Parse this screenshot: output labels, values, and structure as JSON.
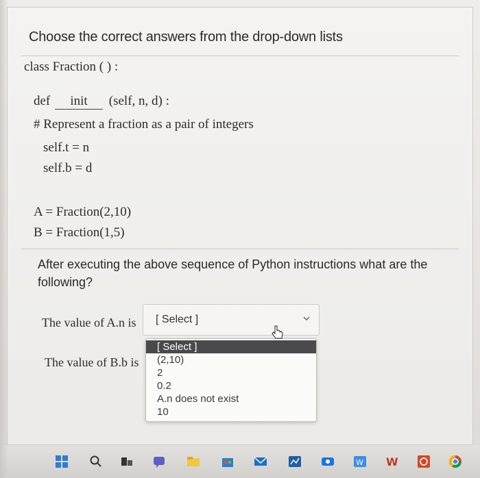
{
  "question": {
    "title": "Choose the correct answers from the drop-down lists",
    "code": {
      "class_line": "class Fraction ( ) :",
      "def_prefix": "def",
      "def_name": "init",
      "def_suffix": "(self, n, d) :",
      "comment": "# Represent a fraction as a pair of integers",
      "assign_t": "self.t = n",
      "assign_b": "self.b = d",
      "a_line": "A = Fraction(2,10)",
      "b_line": "B = Fraction(1,5)"
    },
    "prompt": "After executing the above sequence of Python instructions what are the following?",
    "items": [
      {
        "label": "The value of A.n is",
        "selected": "[ Select ]"
      },
      {
        "label": "The value of B.b is"
      }
    ],
    "dropdown_options": [
      "[ Select ]",
      "(2,10)",
      "2",
      "0.2",
      "A.n does not exist",
      "10"
    ]
  },
  "taskbar": {
    "icons": [
      "windows-icon",
      "search-icon",
      "task-view-icon",
      "chat-icon",
      "file-explorer-icon",
      "store-icon",
      "mail-icon",
      "app-icon",
      "camera-icon",
      "app-icon",
      "word-icon",
      "office-icon",
      "chrome-icon"
    ]
  },
  "colors": {
    "highlight": "#4a4a4d",
    "panel": "#f4f3f1"
  }
}
